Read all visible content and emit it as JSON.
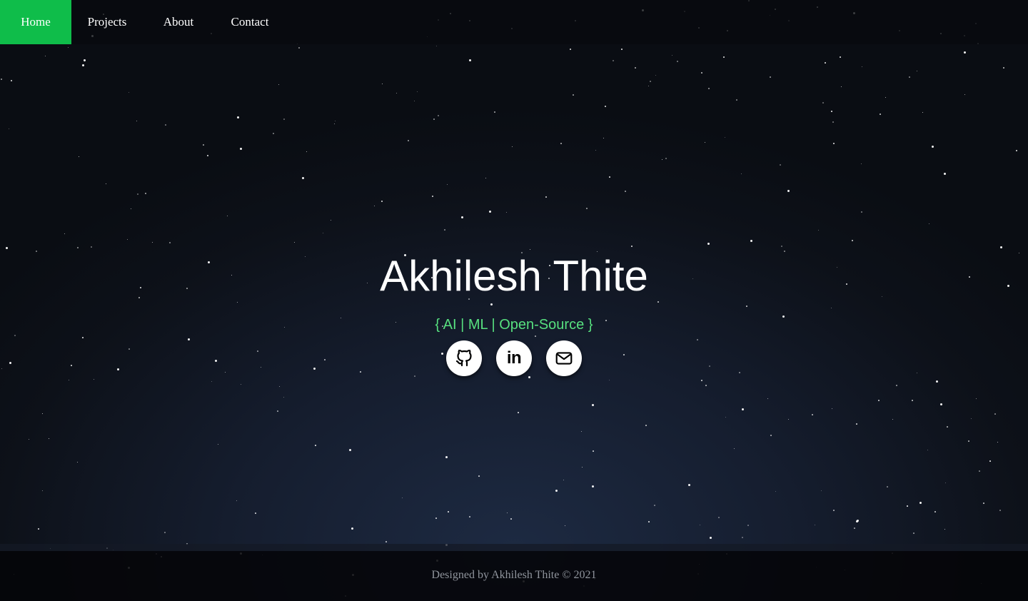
{
  "nav": {
    "items": [
      {
        "label": "Home",
        "active": true
      },
      {
        "label": "Projects",
        "active": false
      },
      {
        "label": "About",
        "active": false
      },
      {
        "label": "Contact",
        "active": false
      }
    ]
  },
  "hero": {
    "title": "Akhilesh Thite",
    "tagline": "{ AI | ML | Open-Source }",
    "socials": [
      {
        "icon": "github-icon"
      },
      {
        "icon": "linkedin-icon",
        "glyph": "in"
      },
      {
        "icon": "mail-icon"
      }
    ]
  },
  "footer": {
    "text": "Designed by Akhilesh Thite © 2021"
  },
  "colors": {
    "accent": "#0fbd4a",
    "tagline": "#57e07f",
    "background": "#151d2e",
    "navbar": "#080a0e"
  }
}
